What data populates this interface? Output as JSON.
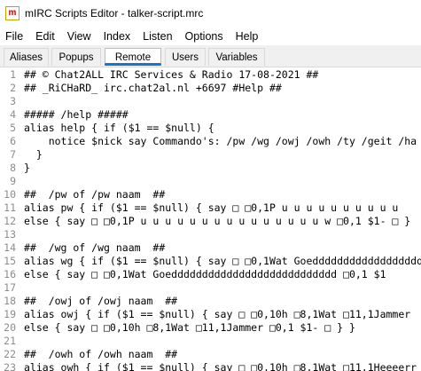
{
  "window": {
    "title": "mIRC Scripts Editor - talker-script.mrc",
    "app_icon_glyph": "m"
  },
  "menu": [
    "File",
    "Edit",
    "View",
    "Index",
    "Listen",
    "Options",
    "Help"
  ],
  "tabs": [
    {
      "label": "Aliases",
      "active": false
    },
    {
      "label": "Popups",
      "active": false
    },
    {
      "label": "Remote",
      "active": true
    },
    {
      "label": "Users",
      "active": false
    },
    {
      "label": "Variables",
      "active": false
    }
  ],
  "colors": {
    "active_tab_underline": "#1a73c9",
    "line_number": "#8c8c8c"
  },
  "editor": {
    "lines": [
      {
        "n": "1",
        "text": "## © Chat2ALL IRC Services & Radio 17-08-2021 ##"
      },
      {
        "n": "2",
        "text": "## _RiCHaRD_ irc.chat2al.nl +6697 #Help ##"
      },
      {
        "n": "3",
        "text": ""
      },
      {
        "n": "4",
        "text": "##### /help #####"
      },
      {
        "n": "5",
        "text": "alias help { if ($1 == $null) {"
      },
      {
        "n": "6",
        "text": "    notice $nick say Commando's: /pw /wg /owj /owh /ty /geit /ha"
      },
      {
        "n": "7",
        "text": "  }"
      },
      {
        "n": "8",
        "text": "}"
      },
      {
        "n": "9",
        "text": ""
      },
      {
        "n": "10",
        "text": "##  /pw of /pw naam  ##"
      },
      {
        "n": "11",
        "text": "alias pw { if ($1 == $null) { say □ □0,1P u u u u u u u u u u"
      },
      {
        "n": "12",
        "text": "else { say □ □0,1P u u u u u u u u u u u u u u u w □0,1 $1- □ }"
      },
      {
        "n": "13",
        "text": ""
      },
      {
        "n": "14",
        "text": "##  /wg of /wg naam  ##"
      },
      {
        "n": "15",
        "text": "alias wg { if ($1 == $null) { say □ □0,1Wat Goedddddddddddddddddd"
      },
      {
        "n": "16",
        "text": "else { say □ □0,1Wat Goeddddddddddddddddddddddddddd □0,1 $1"
      },
      {
        "n": "17",
        "text": ""
      },
      {
        "n": "18",
        "text": "##  /owj of /owj naam  ##"
      },
      {
        "n": "19",
        "text": "alias owj { if ($1 == $null) { say □ □0,10h □8,1Wat □11,1Jammer"
      },
      {
        "n": "20",
        "text": "else { say □ □0,10h □8,1Wat □11,1Jammer □0,1 $1- □ } }"
      },
      {
        "n": "21",
        "text": ""
      },
      {
        "n": "22",
        "text": "##  /owh of /owh naam  ##"
      },
      {
        "n": "23",
        "text": "alias owh { if ($1 == $null) { say □ □0,10h □8,1Wat □11,1Heeeerr"
      }
    ]
  }
}
